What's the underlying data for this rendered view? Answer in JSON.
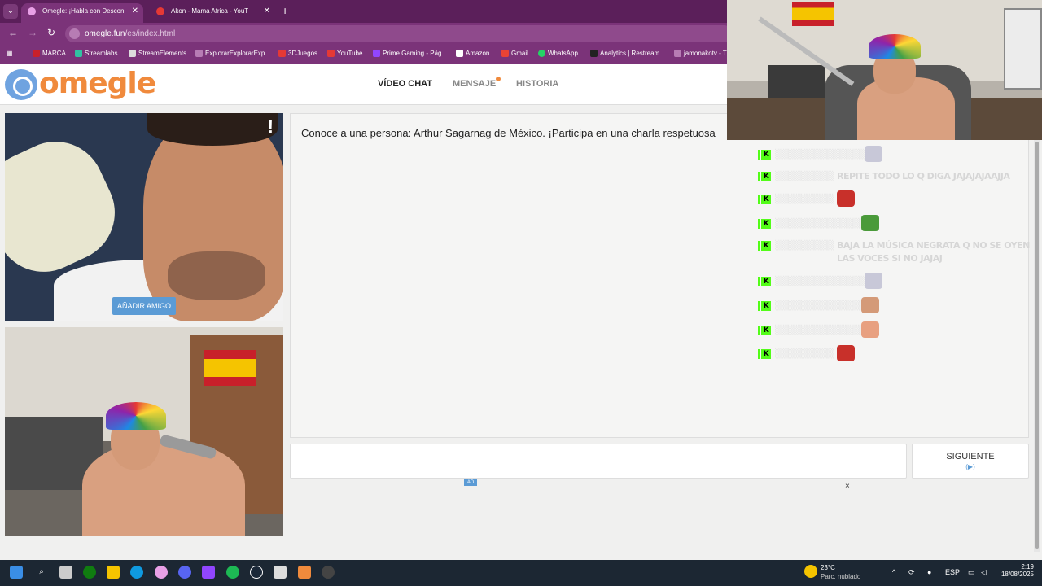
{
  "browser": {
    "tabs": [
      {
        "title": "Omegle: ¡Habla con Descon",
        "active": true
      },
      {
        "title": "Akon - Mama Africa - YouT",
        "active": false
      }
    ],
    "url_domain": "omegle.fun",
    "url_path": "/es/index.html",
    "bookmarks": [
      "MARCA",
      "Streamlabs",
      "StreamElements",
      "ExplorarExplorarExp...",
      "3DJuegos",
      "YouTube",
      "Prime Gaming - Pág...",
      "Amazon",
      "Gmail",
      "WhatsApp",
      "Analytics | Restream...",
      "jamonakotv - T"
    ]
  },
  "omegle": {
    "logo": "omegle",
    "nav": [
      "VÍDEO CHAT",
      "MENSAJE",
      "HISTORIA"
    ],
    "add_friend": "AÑADIR AMIGO",
    "report": "!",
    "chat_message": "Conoce a una persona: Arthur Sagarnag de México. ¡Participa en una charla respetuosa",
    "next_label": "SIGUIENTE",
    "next_arrow": "(▶)",
    "ad_badge": "AD",
    "ad_close": "×"
  },
  "stream_chat": [
    {
      "message": "",
      "emote": "#c8c8d8"
    },
    {
      "message": "REPITE TODO LO Q DIGA JAJAJAJAAJJA",
      "emote": ""
    },
    {
      "message": "",
      "emote": "#c8302a"
    },
    {
      "message": "",
      "emote": "#4a9a3a"
    },
    {
      "message": "BAJA LA MÚSICA NEGRATA Q NO SE OYEN LAS VOCES SI NO JAJAJ",
      "emote": ""
    },
    {
      "message": "",
      "emote": "#c8c8d8"
    },
    {
      "message": "",
      "emote": "#d49a78"
    },
    {
      "message": "",
      "emote": "#e8a080"
    },
    {
      "message": "",
      "emote": "#c8302a"
    }
  ],
  "taskbar": {
    "weather_temp": "23°C",
    "weather_desc": "Parc. nublado",
    "language": "ESP",
    "time": "2:19",
    "date": "18/08/2025"
  },
  "colors": {
    "chrome": "#7b3379",
    "tabbar": "#5b1f5a",
    "logo_orange": "#f08a3c",
    "logo_blue": "#6fa3e0",
    "kick_green": "#53fc18"
  }
}
